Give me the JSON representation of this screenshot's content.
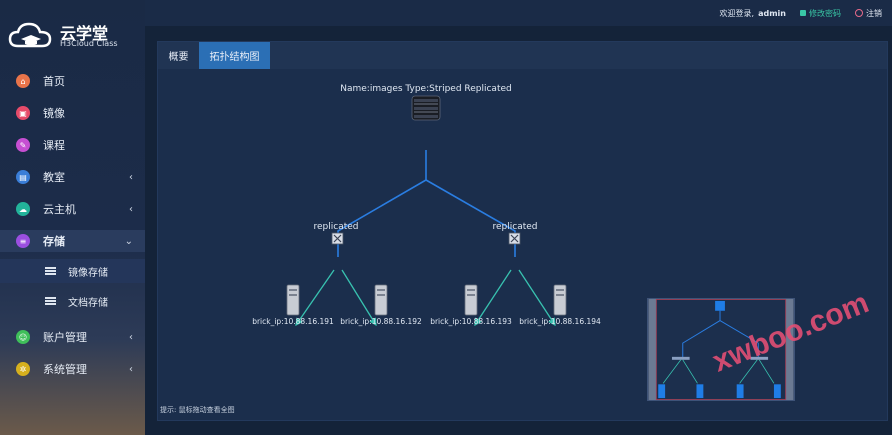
{
  "brand": {
    "title": "云学堂",
    "subtitle": "H3Cloud Class"
  },
  "header": {
    "welcome": "欢迎登录,",
    "user": "admin",
    "change_password": "修改密码",
    "logout": "注销"
  },
  "sidebar": {
    "items": [
      {
        "label": "首页",
        "icon": "home-icon",
        "color": "#e8744a"
      },
      {
        "label": "镜像",
        "icon": "image-icon",
        "color": "#e64b6a"
      },
      {
        "label": "课程",
        "icon": "course-icon",
        "color": "#c64fd2"
      },
      {
        "label": "教室",
        "icon": "classroom-icon",
        "color": "#3a7ed8"
      },
      {
        "label": "云主机",
        "icon": "cloud-host-icon",
        "color": "#22b39a"
      },
      {
        "label": "存储",
        "icon": "storage-icon",
        "color": "#9b4fe0"
      },
      {
        "label": "账户管理",
        "icon": "account-icon",
        "color": "#3fbf5a"
      },
      {
        "label": "系统管理",
        "icon": "settings-icon",
        "color": "#d6b01e"
      }
    ],
    "sub_items": [
      {
        "label": "镜像存储"
      },
      {
        "label": "文档存储"
      }
    ]
  },
  "tabs": [
    {
      "label": "概要"
    },
    {
      "label": "拓扑结构图"
    }
  ],
  "topology": {
    "root_label": "Name:images Type:Striped Replicated",
    "groups": [
      {
        "label": "replicated",
        "bricks": [
          "brick_ip:10.88.16.191",
          "brick_ip:10.88.16.192"
        ]
      },
      {
        "label": "replicated",
        "bricks": [
          "brick_ip:10.88.16.193",
          "brick_ip:10.88.16.194"
        ]
      }
    ]
  },
  "hint": "提示:  鼠标拖动查看全图",
  "watermark": "xwboo.com",
  "colors": {
    "accent": "#2b6fb5",
    "link": "#2a7de1",
    "teal": "#38c2b0",
    "password": "#39c7a6"
  }
}
